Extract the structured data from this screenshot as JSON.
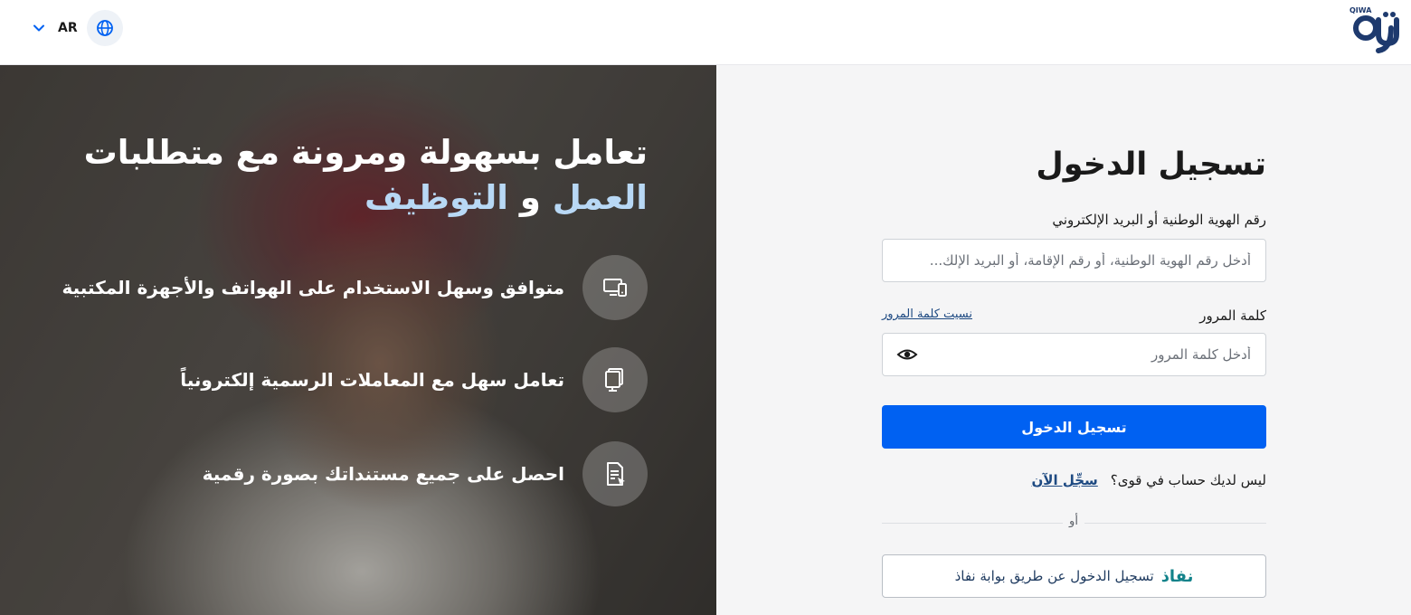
{
  "header": {
    "lang_code": "AR",
    "logo_text": "QIWA",
    "icons": {
      "language": "globe-icon",
      "dropdown": "chevron-down-icon"
    },
    "colors": {
      "logo": "#1e3a6e",
      "globe": "#0061f2"
    }
  },
  "hero": {
    "headline_line1": "تعامل بسهولة ومرونة مع متطلبات",
    "headline_word_work": "العمل",
    "headline_and": "و",
    "headline_word_employment": "التوظيف",
    "features": [
      {
        "icon": "devices-icon",
        "text": "متوافق وسهل الاستخدام على الهواتف والأجهزة المكتبية"
      },
      {
        "icon": "documents-icon",
        "text": "تعامل سهل مع المعاملات الرسمية إلكترونياً"
      },
      {
        "icon": "digital-document-icon",
        "text": "احصل على جميع مستنداتك بصورة رقمية"
      }
    ],
    "colors": {
      "highlight": "#b8d8f5"
    }
  },
  "login": {
    "title": "تسجيل الدخول",
    "id_label": "رقم الهوية الوطنية أو البريد الإلكتروني",
    "id_placeholder": "أدخل رقم الهوية الوطنية، أو رقم الإقامة، أو البريد الإلك...",
    "id_value": "",
    "password_label": "كلمة المرور",
    "forgot_password": "نسيت كلمة المرور",
    "password_placeholder": "أدخل كلمة المرور",
    "password_value": "",
    "submit_label": "تسجيل الدخول",
    "no_account_text": "ليس لديك حساب في قوى؟",
    "register_link": "سجِّل الآن",
    "or_text": "أو",
    "nafath_logo": "نفاذ",
    "nafath_label": "تسجيل الدخول عن طريق بوابة نفاذ",
    "colors": {
      "primary": "#0061f2",
      "link": "#1e4a82",
      "nafath": "#12828a"
    }
  }
}
